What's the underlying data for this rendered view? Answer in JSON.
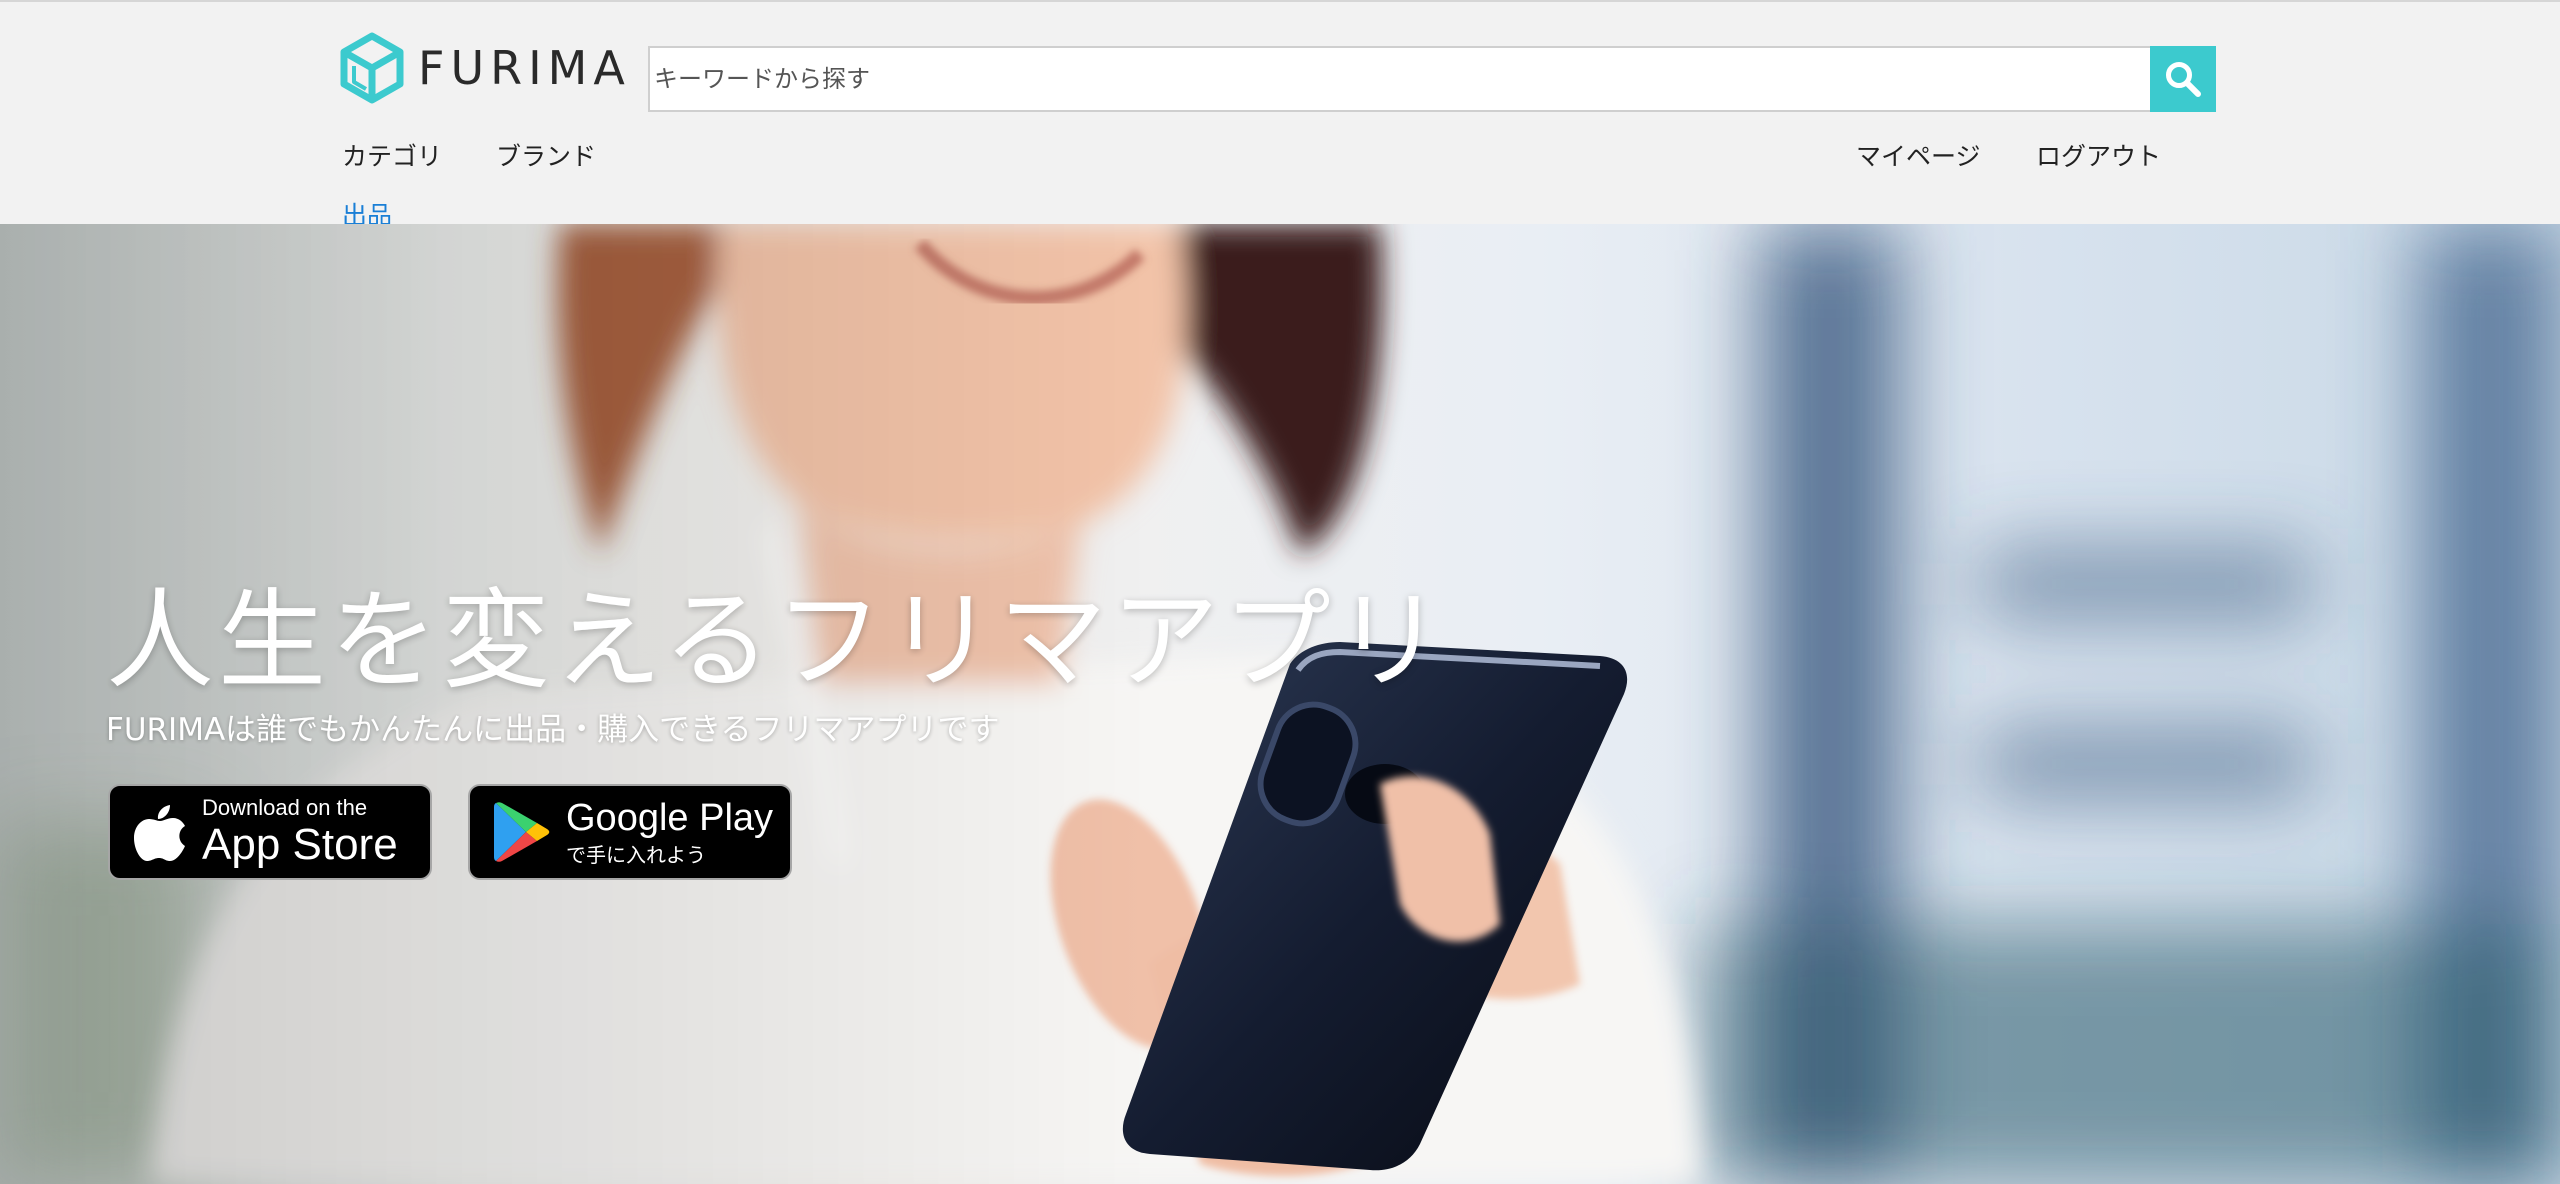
{
  "header": {
    "logo_text": "FURIMA",
    "search": {
      "placeholder": "キーワードから探す",
      "value": ""
    },
    "nav_left": {
      "category": "カテゴリ",
      "brand": "ブランド",
      "sell": "出品"
    },
    "nav_right": {
      "mypage": "マイページ",
      "logout": "ログアウト"
    }
  },
  "hero": {
    "title": "人生を変えるフリマアプリ",
    "subtitle": "FURIMAは誰でもかんたんに出品・購入できるフリマアプリです",
    "app_store": {
      "small": "Download on the",
      "big": "App Store"
    },
    "google_play": {
      "big": "Google Play",
      "small": "で手に入れよう"
    }
  },
  "colors": {
    "accent": "#3ccace",
    "header_bg": "#f2f2f2",
    "sell_link": "#1a7fd6"
  },
  "icons": {
    "logo": "cube-logo-icon",
    "search": "magnifier-icon",
    "apple": "apple-icon",
    "google_play": "google-play-icon"
  }
}
